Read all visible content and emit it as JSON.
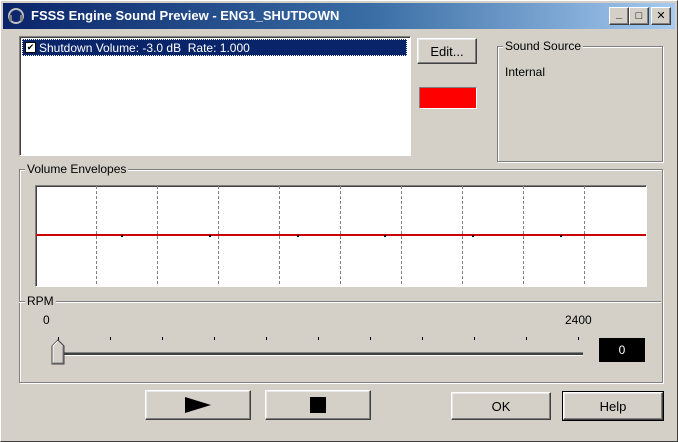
{
  "window": {
    "title": "FSSS Engine Sound Preview - ENG1_SHUTDOWN",
    "icon": "speaker-headphones-icon",
    "controls": {
      "minimize": "_",
      "maximize": "□",
      "close": "✕"
    }
  },
  "sound_list": {
    "items": [
      {
        "checked": true,
        "label": "Shutdown Volume: -3.0 dB  Rate: 1.000"
      }
    ]
  },
  "edit_button": {
    "label": "Edit..."
  },
  "swatch": {
    "color": "#ff0000"
  },
  "sound_source": {
    "title": "Sound Source",
    "value": "Internal"
  },
  "volume_envelopes": {
    "title": "Volume Envelopes",
    "line_color": "#cc0000"
  },
  "rpm": {
    "title": "RPM",
    "min_label": "0",
    "max_label": "2400",
    "min": 0,
    "max": 2400,
    "value": 0,
    "readout": "0"
  },
  "buttons": {
    "play": "play-icon",
    "stop": "stop-icon",
    "ok": "OK",
    "help": "Help"
  }
}
